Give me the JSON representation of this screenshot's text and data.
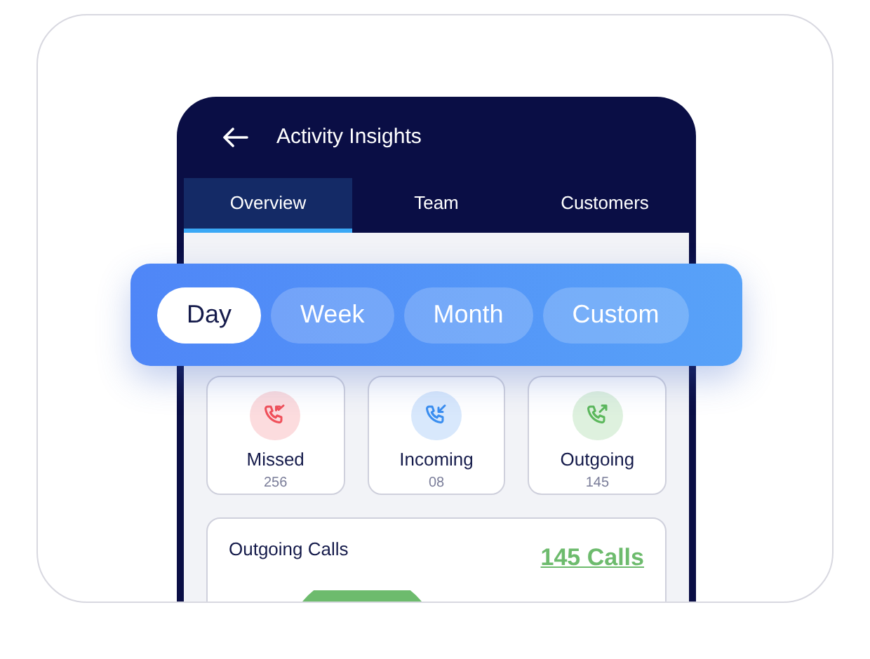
{
  "header": {
    "title": "Activity Insights"
  },
  "tabs": [
    {
      "label": "Overview",
      "selected": true
    },
    {
      "label": "Team",
      "selected": false
    },
    {
      "label": "Customers",
      "selected": false
    }
  ],
  "filters": [
    {
      "label": "Day",
      "selected": true
    },
    {
      "label": "Week",
      "selected": false
    },
    {
      "label": "Month",
      "selected": false
    },
    {
      "label": "Custom",
      "selected": false
    }
  ],
  "stats": [
    {
      "kind": "missed",
      "label": "Missed",
      "count": "256",
      "color": "#f0505a"
    },
    {
      "kind": "incoming",
      "label": "Incoming",
      "count": "08",
      "color": "#3a8ef0"
    },
    {
      "kind": "outgoing",
      "label": "Outgoing",
      "count": "145",
      "color": "#5cb85c"
    }
  ],
  "chart_card": {
    "title": "Outgoing Calls",
    "total": "145 Calls"
  }
}
